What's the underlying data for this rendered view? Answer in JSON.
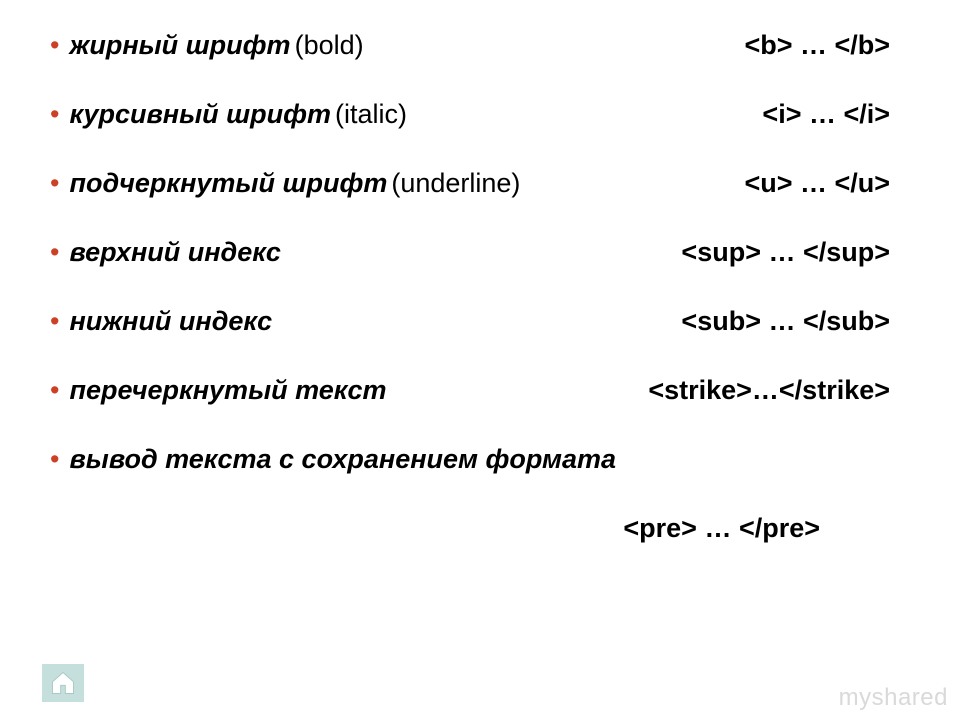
{
  "items": [
    {
      "term": "жирный шрифт",
      "paren": "(bold)",
      "code": "<b> … </b>"
    },
    {
      "term": "курсивный шрифт",
      "paren": "(italic)",
      "code": "<i> … </i>"
    },
    {
      "term": "подчеркнутый шрифт",
      "paren": "(underline)",
      "code": "<u> … </u>"
    },
    {
      "term": "верхний индекс",
      "paren": "",
      "code": "<sup> … </sup>"
    },
    {
      "term": "нижний индекс",
      "paren": "",
      "code": "<sub> … </sub>"
    },
    {
      "term": "перечеркнутый текст",
      "paren": "",
      "code": "<strike>…</strike>"
    }
  ],
  "last_item": {
    "term": "вывод текста с сохранением формата",
    "code": "<pre> … </pre>"
  },
  "watermark": "myshared",
  "icons": {
    "home": "home-icon"
  },
  "colors": {
    "bullet": "#cc4125",
    "home_bg": "#c5e0dc",
    "watermark": "#d9d9d9"
  }
}
